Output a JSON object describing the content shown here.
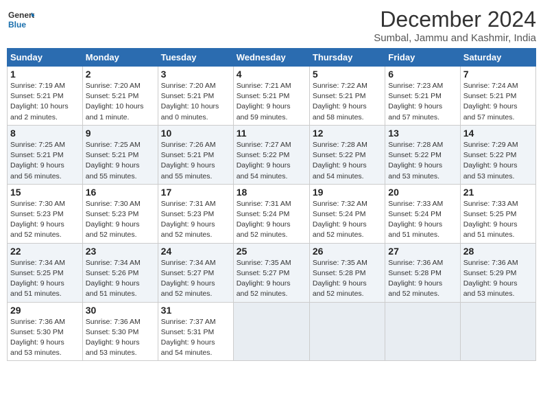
{
  "logo": {
    "line1": "General",
    "line2": "Blue"
  },
  "title": "December 2024",
  "subtitle": "Sumbal, Jammu and Kashmir, India",
  "days_header": [
    "Sunday",
    "Monday",
    "Tuesday",
    "Wednesday",
    "Thursday",
    "Friday",
    "Saturday"
  ],
  "weeks": [
    [
      {
        "day": "1",
        "info": "Sunrise: 7:19 AM\nSunset: 5:21 PM\nDaylight: 10 hours\nand 2 minutes."
      },
      {
        "day": "2",
        "info": "Sunrise: 7:20 AM\nSunset: 5:21 PM\nDaylight: 10 hours\nand 1 minute."
      },
      {
        "day": "3",
        "info": "Sunrise: 7:20 AM\nSunset: 5:21 PM\nDaylight: 10 hours\nand 0 minutes."
      },
      {
        "day": "4",
        "info": "Sunrise: 7:21 AM\nSunset: 5:21 PM\nDaylight: 9 hours\nand 59 minutes."
      },
      {
        "day": "5",
        "info": "Sunrise: 7:22 AM\nSunset: 5:21 PM\nDaylight: 9 hours\nand 58 minutes."
      },
      {
        "day": "6",
        "info": "Sunrise: 7:23 AM\nSunset: 5:21 PM\nDaylight: 9 hours\nand 57 minutes."
      },
      {
        "day": "7",
        "info": "Sunrise: 7:24 AM\nSunset: 5:21 PM\nDaylight: 9 hours\nand 57 minutes."
      }
    ],
    [
      {
        "day": "8",
        "info": "Sunrise: 7:25 AM\nSunset: 5:21 PM\nDaylight: 9 hours\nand 56 minutes."
      },
      {
        "day": "9",
        "info": "Sunrise: 7:25 AM\nSunset: 5:21 PM\nDaylight: 9 hours\nand 55 minutes."
      },
      {
        "day": "10",
        "info": "Sunrise: 7:26 AM\nSunset: 5:21 PM\nDaylight: 9 hours\nand 55 minutes."
      },
      {
        "day": "11",
        "info": "Sunrise: 7:27 AM\nSunset: 5:22 PM\nDaylight: 9 hours\nand 54 minutes."
      },
      {
        "day": "12",
        "info": "Sunrise: 7:28 AM\nSunset: 5:22 PM\nDaylight: 9 hours\nand 54 minutes."
      },
      {
        "day": "13",
        "info": "Sunrise: 7:28 AM\nSunset: 5:22 PM\nDaylight: 9 hours\nand 53 minutes."
      },
      {
        "day": "14",
        "info": "Sunrise: 7:29 AM\nSunset: 5:22 PM\nDaylight: 9 hours\nand 53 minutes."
      }
    ],
    [
      {
        "day": "15",
        "info": "Sunrise: 7:30 AM\nSunset: 5:23 PM\nDaylight: 9 hours\nand 52 minutes."
      },
      {
        "day": "16",
        "info": "Sunrise: 7:30 AM\nSunset: 5:23 PM\nDaylight: 9 hours\nand 52 minutes."
      },
      {
        "day": "17",
        "info": "Sunrise: 7:31 AM\nSunset: 5:23 PM\nDaylight: 9 hours\nand 52 minutes."
      },
      {
        "day": "18",
        "info": "Sunrise: 7:31 AM\nSunset: 5:24 PM\nDaylight: 9 hours\nand 52 minutes."
      },
      {
        "day": "19",
        "info": "Sunrise: 7:32 AM\nSunset: 5:24 PM\nDaylight: 9 hours\nand 52 minutes."
      },
      {
        "day": "20",
        "info": "Sunrise: 7:33 AM\nSunset: 5:24 PM\nDaylight: 9 hours\nand 51 minutes."
      },
      {
        "day": "21",
        "info": "Sunrise: 7:33 AM\nSunset: 5:25 PM\nDaylight: 9 hours\nand 51 minutes."
      }
    ],
    [
      {
        "day": "22",
        "info": "Sunrise: 7:34 AM\nSunset: 5:25 PM\nDaylight: 9 hours\nand 51 minutes."
      },
      {
        "day": "23",
        "info": "Sunrise: 7:34 AM\nSunset: 5:26 PM\nDaylight: 9 hours\nand 51 minutes."
      },
      {
        "day": "24",
        "info": "Sunrise: 7:34 AM\nSunset: 5:27 PM\nDaylight: 9 hours\nand 52 minutes."
      },
      {
        "day": "25",
        "info": "Sunrise: 7:35 AM\nSunset: 5:27 PM\nDaylight: 9 hours\nand 52 minutes."
      },
      {
        "day": "26",
        "info": "Sunrise: 7:35 AM\nSunset: 5:28 PM\nDaylight: 9 hours\nand 52 minutes."
      },
      {
        "day": "27",
        "info": "Sunrise: 7:36 AM\nSunset: 5:28 PM\nDaylight: 9 hours\nand 52 minutes."
      },
      {
        "day": "28",
        "info": "Sunrise: 7:36 AM\nSunset: 5:29 PM\nDaylight: 9 hours\nand 53 minutes."
      }
    ],
    [
      {
        "day": "29",
        "info": "Sunrise: 7:36 AM\nSunset: 5:30 PM\nDaylight: 9 hours\nand 53 minutes."
      },
      {
        "day": "30",
        "info": "Sunrise: 7:36 AM\nSunset: 5:30 PM\nDaylight: 9 hours\nand 53 minutes."
      },
      {
        "day": "31",
        "info": "Sunrise: 7:37 AM\nSunset: 5:31 PM\nDaylight: 9 hours\nand 54 minutes."
      },
      {
        "day": "",
        "info": ""
      },
      {
        "day": "",
        "info": ""
      },
      {
        "day": "",
        "info": ""
      },
      {
        "day": "",
        "info": ""
      }
    ]
  ]
}
